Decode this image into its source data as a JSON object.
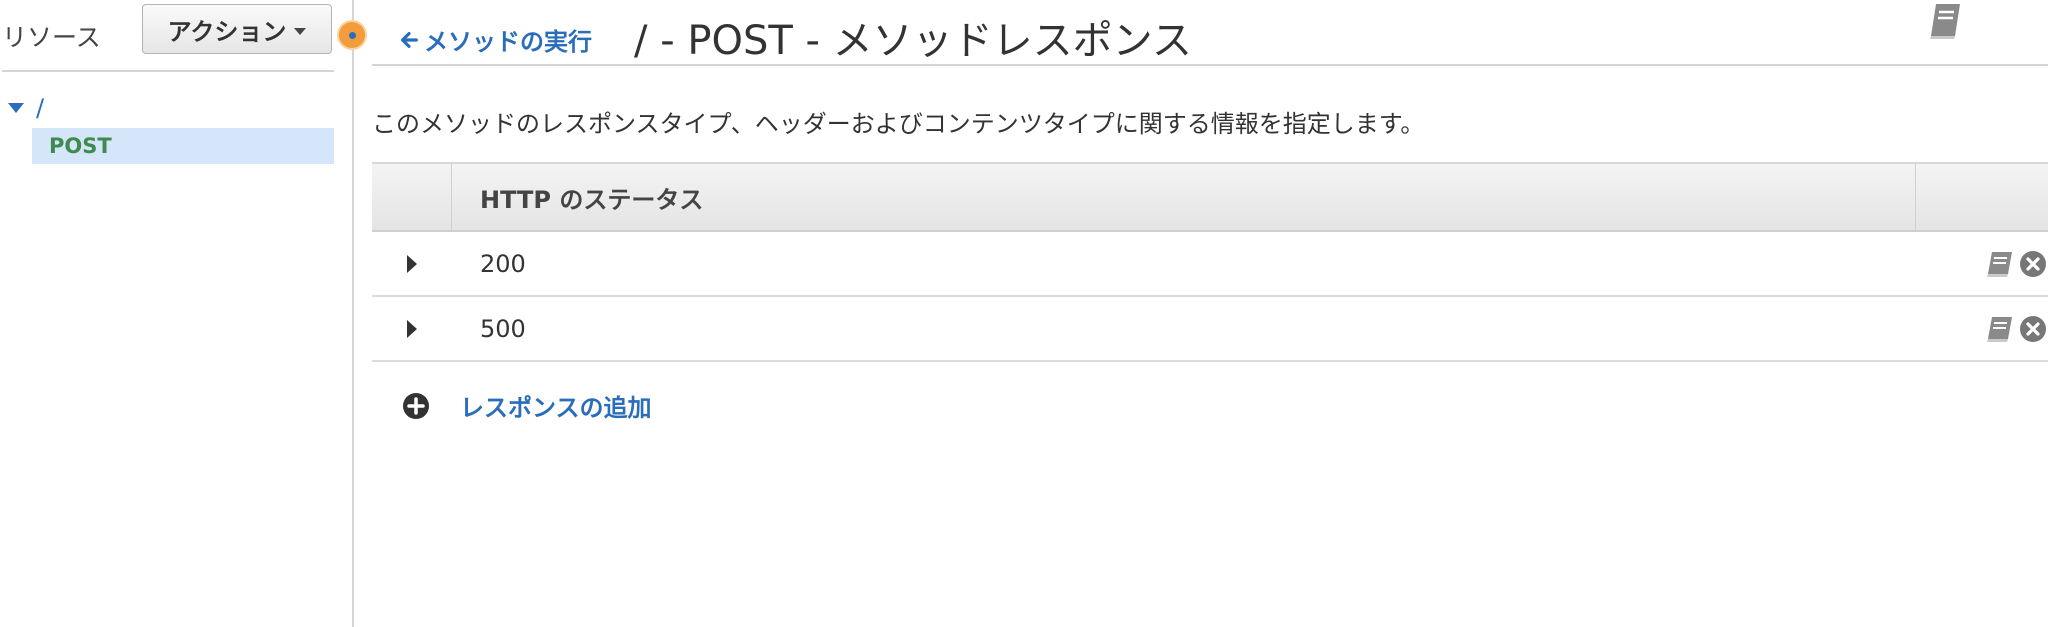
{
  "sidebar": {
    "title": "リソース",
    "actions_label": "アクション",
    "tree": {
      "root_label": "/",
      "items": [
        {
          "label": "POST"
        }
      ]
    }
  },
  "header": {
    "back_link": "メソッドの実行",
    "title": "/ - POST - メソッドレスポンス"
  },
  "description": "このメソッドのレスポンスタイプ、ヘッダーおよびコンテンツタイプに関する情報を指定します。",
  "table": {
    "columns": [
      "HTTP のステータス"
    ],
    "rows": [
      {
        "status": "200"
      },
      {
        "status": "500"
      }
    ]
  },
  "add_response_label": "レスポンスの追加",
  "colors": {
    "link": "#2a6ebb",
    "method_post": "#3f8a4e",
    "selected_bg": "#d6e6fa",
    "handle": "#f39c3c"
  },
  "icons": [
    "arrow-left-icon",
    "book-icon",
    "remove-circle-icon",
    "add-circle-icon",
    "caret-down-icon",
    "triangle-right-icon"
  ]
}
